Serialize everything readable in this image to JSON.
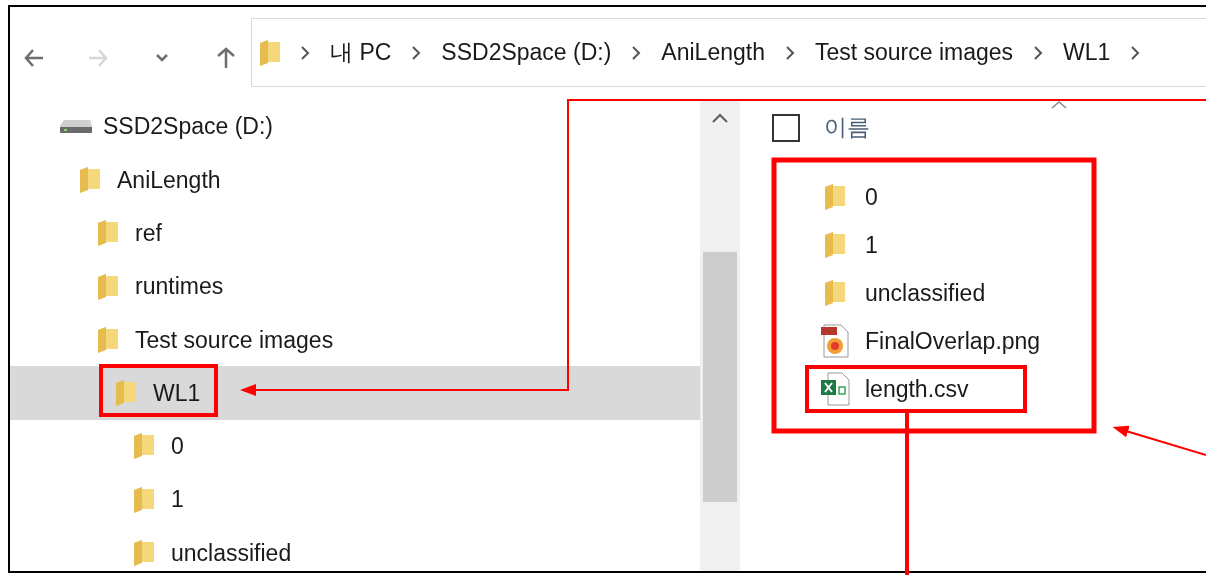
{
  "nav_buttons": [
    {
      "kind": "back",
      "disabled": false
    },
    {
      "kind": "forward",
      "disabled": true
    },
    {
      "kind": "recent",
      "disabled": false
    },
    {
      "kind": "up",
      "disabled": false
    }
  ],
  "address_bar": {
    "segments": [
      "내 PC",
      "SSD2Space (D:)",
      "AniLength",
      "Test source images",
      "WL1"
    ]
  },
  "tree": [
    {
      "label": "SSD2Space (D:)",
      "kind": "drive",
      "selected": false,
      "children": [
        {
          "label": "AniLength",
          "kind": "folder",
          "selected": false,
          "children": [
            {
              "label": "ref",
              "kind": "folder",
              "selected": false
            },
            {
              "label": "runtimes",
              "kind": "folder",
              "selected": false
            },
            {
              "label": "Test source images",
              "kind": "folder",
              "selected": false,
              "children": [
                {
                  "label": "WL1",
                  "kind": "folder",
                  "selected": true,
                  "children": [
                    {
                      "label": "0",
                      "kind": "folder",
                      "selected": false
                    },
                    {
                      "label": "1",
                      "kind": "folder",
                      "selected": false
                    },
                    {
                      "label": "unclassified",
                      "kind": "folder",
                      "selected": false
                    }
                  ]
                }
              ]
            }
          ]
        }
      ]
    }
  ],
  "file_list": {
    "header": {
      "name_column": "이름",
      "checked": false
    },
    "items": [
      {
        "name": "0",
        "kind": "folder"
      },
      {
        "name": "1",
        "kind": "folder"
      },
      {
        "name": "unclassified",
        "kind": "folder"
      },
      {
        "name": "FinalOverlap.png",
        "kind": "image"
      },
      {
        "name": "length.csv",
        "kind": "spreadsheet"
      }
    ]
  }
}
